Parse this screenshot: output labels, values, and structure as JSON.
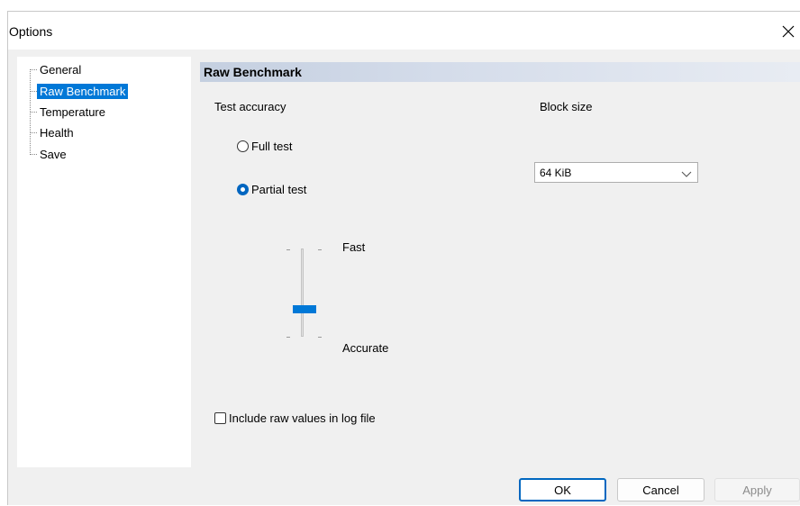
{
  "window": {
    "title": "Options"
  },
  "tree": {
    "items": [
      {
        "label": "General",
        "selected": false
      },
      {
        "label": "Raw Benchmark",
        "selected": true
      },
      {
        "label": "Temperature",
        "selected": false
      },
      {
        "label": "Health",
        "selected": false
      },
      {
        "label": "Save",
        "selected": false
      }
    ]
  },
  "section": {
    "title": "Raw Benchmark"
  },
  "accuracy": {
    "label": "Test accuracy",
    "full_test": "Full test",
    "partial_test": "Partial test",
    "selected": "partial",
    "slider_fast": "Fast",
    "slider_accurate": "Accurate",
    "slider_value_fraction": 0.75
  },
  "block_size": {
    "label": "Block size",
    "value": "64 KiB"
  },
  "log_option": {
    "label": "Include raw values in log file",
    "checked": false
  },
  "buttons": {
    "ok": "OK",
    "cancel": "Cancel",
    "apply": "Apply"
  },
  "colors": {
    "accent": "#0078d7",
    "selection": "#0078d7",
    "header_gradient_start": "#c4cfe0"
  },
  "icons": {
    "close": "close-icon",
    "dropdown": "chevron-down-icon"
  }
}
